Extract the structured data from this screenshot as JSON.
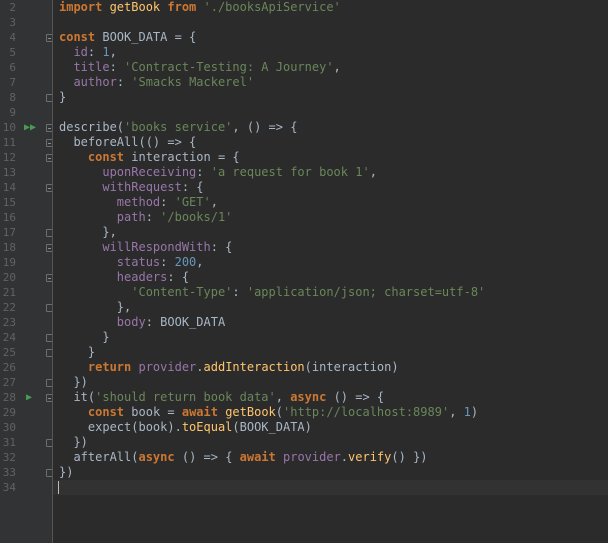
{
  "editor": {
    "gutter_icons": {
      "run_all": "run-all-icon",
      "run_test": "run-test-icon",
      "fold": "fold-icon"
    },
    "colors": {
      "background": "#2b2b2b",
      "gutter": "#313335",
      "keyword": "#cc7832",
      "string": "#6a8759",
      "number": "#6897bb",
      "property": "#9876aa",
      "function": "#ffc66d",
      "plain": "#a9b7c6",
      "run_marker": "#499c54"
    },
    "lines": [
      {
        "n": "2",
        "tokens": [
          [
            "kw",
            "import "
          ],
          [
            "fn",
            "getBook "
          ],
          [
            "kw",
            "from "
          ],
          [
            "str",
            "'./booksApiService'"
          ]
        ]
      },
      {
        "n": "3",
        "tokens": []
      },
      {
        "n": "4",
        "tokens": [
          [
            "kw",
            "const "
          ],
          [
            "plain",
            "BOOK_DATA = {"
          ]
        ]
      },
      {
        "n": "5",
        "tokens": [
          [
            "plain",
            "  "
          ],
          [
            "prop",
            "id"
          ],
          [
            "plain",
            ": "
          ],
          [
            "num",
            "1"
          ],
          [
            "plain",
            ","
          ]
        ]
      },
      {
        "n": "6",
        "tokens": [
          [
            "plain",
            "  "
          ],
          [
            "prop",
            "title"
          ],
          [
            "plain",
            ": "
          ],
          [
            "str",
            "'Contract-Testing: A Journey'"
          ],
          [
            "plain",
            ","
          ]
        ]
      },
      {
        "n": "7",
        "tokens": [
          [
            "plain",
            "  "
          ],
          [
            "prop",
            "author"
          ],
          [
            "plain",
            ": "
          ],
          [
            "str",
            "'Smacks Mackerel'"
          ]
        ]
      },
      {
        "n": "8",
        "tokens": [
          [
            "plain",
            "}"
          ]
        ]
      },
      {
        "n": "9",
        "tokens": []
      },
      {
        "n": "10",
        "tokens": [
          [
            "plain",
            "describe("
          ],
          [
            "str",
            "'books service'"
          ],
          [
            "plain",
            ", () => {"
          ]
        ]
      },
      {
        "n": "11",
        "tokens": [
          [
            "plain",
            "  beforeAll(() => {"
          ]
        ]
      },
      {
        "n": "12",
        "tokens": [
          [
            "plain",
            "    "
          ],
          [
            "kw",
            "const "
          ],
          [
            "plain",
            "interaction = {"
          ]
        ]
      },
      {
        "n": "13",
        "tokens": [
          [
            "plain",
            "      "
          ],
          [
            "prop",
            "uponReceiving"
          ],
          [
            "plain",
            ": "
          ],
          [
            "str",
            "'a request for book 1'"
          ],
          [
            "plain",
            ","
          ]
        ]
      },
      {
        "n": "14",
        "tokens": [
          [
            "plain",
            "      "
          ],
          [
            "prop",
            "withRequest"
          ],
          [
            "plain",
            ": {"
          ]
        ]
      },
      {
        "n": "15",
        "tokens": [
          [
            "plain",
            "        "
          ],
          [
            "prop",
            "method"
          ],
          [
            "plain",
            ": "
          ],
          [
            "str",
            "'GET'"
          ],
          [
            "plain",
            ","
          ]
        ]
      },
      {
        "n": "16",
        "tokens": [
          [
            "plain",
            "        "
          ],
          [
            "prop",
            "path"
          ],
          [
            "plain",
            ": "
          ],
          [
            "str",
            "'/books/1'"
          ]
        ]
      },
      {
        "n": "17",
        "tokens": [
          [
            "plain",
            "      },"
          ]
        ]
      },
      {
        "n": "18",
        "tokens": [
          [
            "plain",
            "      "
          ],
          [
            "prop",
            "willRespondWith"
          ],
          [
            "plain",
            ": {"
          ]
        ]
      },
      {
        "n": "19",
        "tokens": [
          [
            "plain",
            "        "
          ],
          [
            "prop",
            "status"
          ],
          [
            "plain",
            ": "
          ],
          [
            "num",
            "200"
          ],
          [
            "plain",
            ","
          ]
        ]
      },
      {
        "n": "20",
        "tokens": [
          [
            "plain",
            "        "
          ],
          [
            "prop",
            "headers"
          ],
          [
            "plain",
            ": {"
          ]
        ]
      },
      {
        "n": "21",
        "tokens": [
          [
            "plain",
            "          "
          ],
          [
            "str",
            "'Content-Type'"
          ],
          [
            "plain",
            ": "
          ],
          [
            "str",
            "'application/json; charset=utf-8'"
          ]
        ]
      },
      {
        "n": "22",
        "tokens": [
          [
            "plain",
            "        },"
          ]
        ]
      },
      {
        "n": "23",
        "tokens": [
          [
            "plain",
            "        "
          ],
          [
            "prop",
            "body"
          ],
          [
            "plain",
            ": BOOK_DATA"
          ]
        ]
      },
      {
        "n": "24",
        "tokens": [
          [
            "plain",
            "      }"
          ]
        ]
      },
      {
        "n": "25",
        "tokens": [
          [
            "plain",
            "    }"
          ]
        ]
      },
      {
        "n": "26",
        "tokens": [
          [
            "plain",
            "    "
          ],
          [
            "kw",
            "return "
          ],
          [
            "prop",
            "provider"
          ],
          [
            "plain",
            "."
          ],
          [
            "fn",
            "addInteraction"
          ],
          [
            "plain",
            "(interaction)"
          ]
        ]
      },
      {
        "n": "27",
        "tokens": [
          [
            "plain",
            "  })"
          ]
        ]
      },
      {
        "n": "28",
        "tokens": [
          [
            "plain",
            "  it("
          ],
          [
            "str",
            "'should return book data'"
          ],
          [
            "plain",
            ", "
          ],
          [
            "kw",
            "async "
          ],
          [
            "plain",
            "() => {"
          ]
        ]
      },
      {
        "n": "29",
        "tokens": [
          [
            "plain",
            "    "
          ],
          [
            "kw",
            "const "
          ],
          [
            "plain",
            "book = "
          ],
          [
            "kw",
            "await "
          ],
          [
            "fn",
            "getBook"
          ],
          [
            "plain",
            "("
          ],
          [
            "str",
            "'http://localhost:8989'"
          ],
          [
            "plain",
            ", "
          ],
          [
            "num",
            "1"
          ],
          [
            "plain",
            ")"
          ]
        ]
      },
      {
        "n": "30",
        "tokens": [
          [
            "plain",
            "    expect(book)."
          ],
          [
            "fn",
            "toEqual"
          ],
          [
            "plain",
            "(BOOK_DATA)"
          ]
        ]
      },
      {
        "n": "31",
        "tokens": [
          [
            "plain",
            "  })"
          ]
        ]
      },
      {
        "n": "32",
        "tokens": [
          [
            "plain",
            "  afterAll("
          ],
          [
            "kw",
            "async "
          ],
          [
            "plain",
            "() => { "
          ],
          [
            "kw",
            "await "
          ],
          [
            "prop",
            "provider"
          ],
          [
            "plain",
            "."
          ],
          [
            "fn",
            "verify"
          ],
          [
            "plain",
            "() })"
          ]
        ]
      },
      {
        "n": "33",
        "tokens": [
          [
            "plain",
            "})"
          ]
        ]
      },
      {
        "n": "34",
        "tokens": []
      }
    ]
  }
}
